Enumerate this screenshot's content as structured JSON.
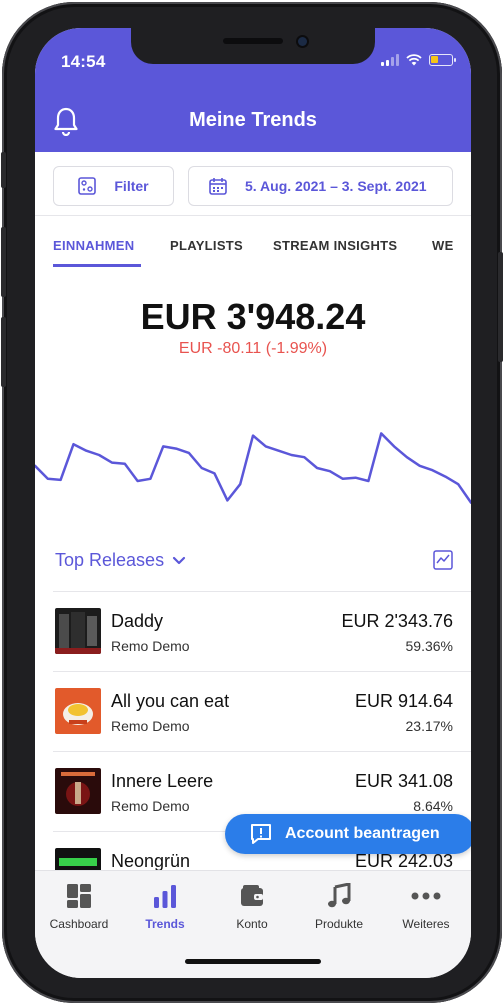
{
  "status": {
    "time": "14:54",
    "battery_level": 0.35
  },
  "header": {
    "title": "Meine Trends"
  },
  "filters": {
    "filter_label": "Filter",
    "date_range": "5. Aug. 2021 – 3. Sept. 2021"
  },
  "tabs": [
    {
      "label": "EINNAHMEN",
      "active": true
    },
    {
      "label": "PLAYLISTS",
      "active": false
    },
    {
      "label": "STREAM INSIGHTS",
      "active": false
    },
    {
      "label": "WE",
      "active": false
    }
  ],
  "summary": {
    "amount": "EUR 3'948.24",
    "delta": "EUR -80.11 (-1.99%)"
  },
  "chart_data": {
    "type": "line",
    "values": [
      52,
      40,
      39,
      72,
      66,
      62,
      55,
      54,
      38,
      40,
      70,
      68,
      64,
      50,
      45,
      20,
      35,
      80,
      70,
      66,
      62,
      60,
      50,
      47,
      40,
      41,
      38,
      82,
      70,
      60,
      52,
      48,
      42,
      35,
      18
    ],
    "color": "#5b57d9",
    "grid": false
  },
  "releases": {
    "title": "Top Releases",
    "items": [
      {
        "title": "Daddy",
        "artist": "Remo Demo",
        "amount": "EUR 2'343.76",
        "percent": "59.36%"
      },
      {
        "title": "All you can eat",
        "artist": "Remo Demo",
        "amount": "EUR 914.64",
        "percent": "23.17%"
      },
      {
        "title": "Innere Leere",
        "artist": "Remo Demo",
        "amount": "EUR 341.08",
        "percent": "8.64%"
      },
      {
        "title": "Neongrün",
        "artist": "",
        "amount": "EUR 242.03",
        "percent": ""
      }
    ]
  },
  "fab": {
    "label": "Account beantragen"
  },
  "tabbar": [
    {
      "label": "Cashboard",
      "icon": "dashboard-icon",
      "active": false
    },
    {
      "label": "Trends",
      "icon": "bar-chart-icon",
      "active": true
    },
    {
      "label": "Konto",
      "icon": "wallet-icon",
      "active": false
    },
    {
      "label": "Produkte",
      "icon": "music-note-icon",
      "active": false
    },
    {
      "label": "Weiteres",
      "icon": "more-dots-icon",
      "active": false
    }
  ],
  "colors": {
    "accent": "#5b57d9",
    "negative": "#e8534f",
    "fab": "#2b7de9"
  }
}
